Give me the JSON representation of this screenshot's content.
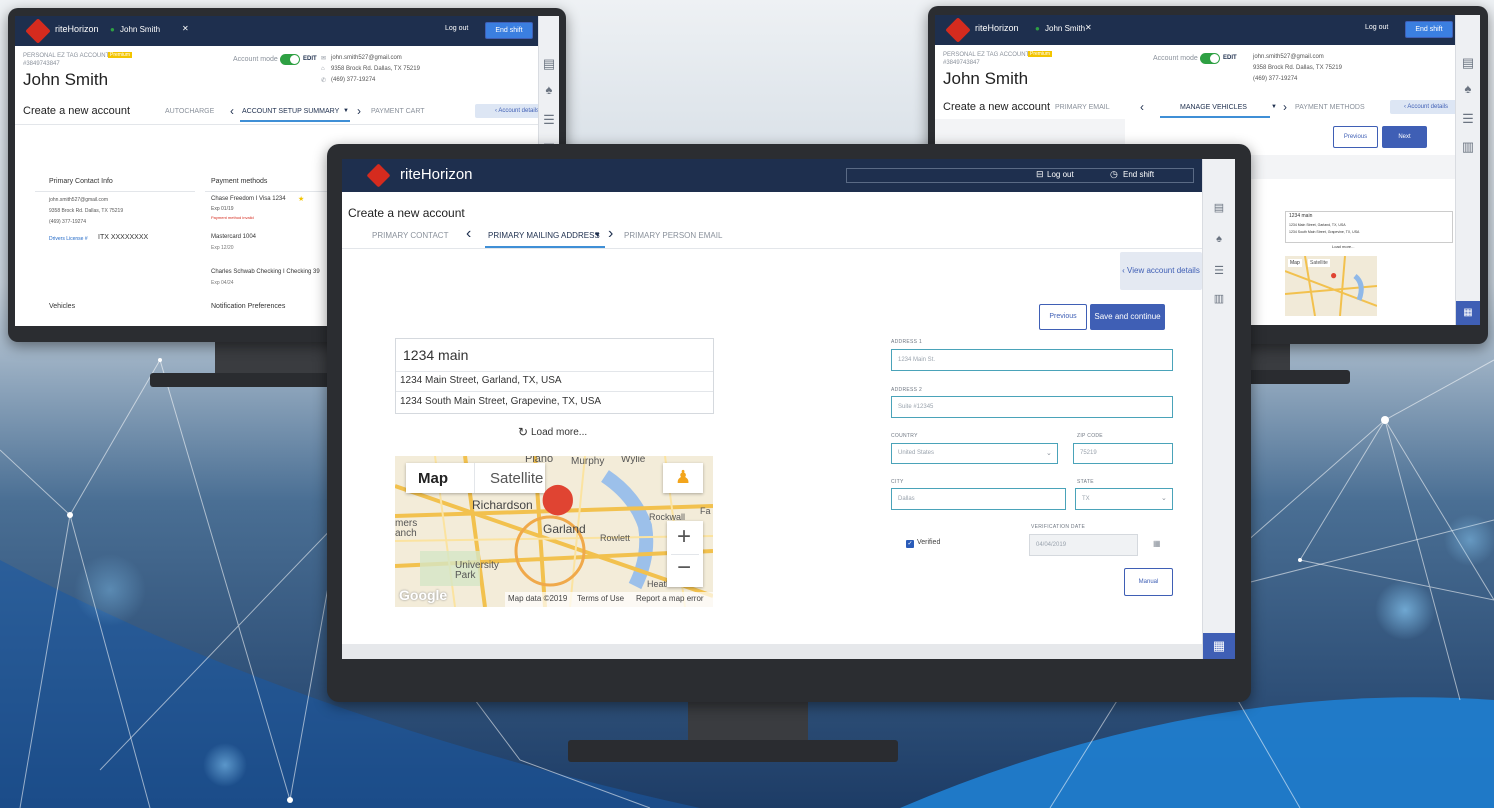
{
  "brand": {
    "logo_text": "riteHorizon",
    "accent": "#d52b1e",
    "nav_bg": "#1e2f4e",
    "primary": "#3f5fb5"
  },
  "left_monitor": {
    "tab_user": "John Smith",
    "logout": "Log out",
    "end_shift": "End shift",
    "account_type": "PERSONAL EZ TAG ACCOUNT",
    "account_badge": "Premium",
    "account_number": "#3849743847",
    "customer_name": "John Smith",
    "account_mode_label": "Account mode",
    "edit_label": "EDIT",
    "email": "john.smith527@gmail.com",
    "address": "9358 Brock Rd. Dallas, TX 75219",
    "phone": "(469) 377-19274",
    "page_title": "Create a new account",
    "step_prev": "AUTOCHARGE",
    "step_current": "ACCOUNT SETUP SUMMARY",
    "step_next": "PAYMENT CART",
    "account_details": "‹ Account details",
    "contact_heading": "Primary Contact Info",
    "contact_email": "john.smith527@gmail.com",
    "contact_address": "9358 Brock Rd. Dallas, TX 75219",
    "contact_phone": "(469) 377-19274",
    "drivers_license_label": "Drivers License #",
    "drivers_license_value": "ITX XXXXXXXX",
    "payment_heading": "Payment methods",
    "pm1_name": "Chase Freedom I Visa 1234",
    "pm1_exp": "Exp 01/19",
    "pm1_warning": "Payment method invalid",
    "pm2_name": "Mastercard 1004",
    "pm2_exp": "Exp 12/20",
    "pm3_name": "Charles Schwab Checking I Checking 39",
    "pm3_exp": "Exp 04/24",
    "vehicles_heading": "Vehicles",
    "notifications_heading": "Notification Preferences"
  },
  "right_monitor": {
    "tab_user": "John Smith",
    "logout": "Log out",
    "end_shift": "End shift",
    "account_type": "PERSONAL EZ TAG ACCOUNT",
    "account_badge": "Premium",
    "account_number": "#3849743847",
    "customer_name": "John Smith",
    "account_mode_label": "Account mode",
    "edit_label": "EDIT",
    "email": "john.smith527@gmail.com",
    "address": "9358 Brock Rd. Dallas, TX 75219",
    "phone": "(469) 377-19274",
    "page_title": "Create a new account",
    "step_prev": "PRIMARY EMAIL",
    "step_current": "MANAGE VEHICLES",
    "step_next": "PAYMENT METHODS",
    "account_details": "‹ Account details",
    "previous": "Previous",
    "next": "Next",
    "search_value": "1234 main",
    "suggestion_1": "1234 Main Street, Garland, TX, USA",
    "suggestion_2": "1234 South Main Street, Grapevine, TX, USA",
    "load_more": "Load more...",
    "map_tab": "Map",
    "satellite_tab": "Satellite"
  },
  "main_monitor": {
    "logout": "Log out",
    "end_shift": "End shift",
    "page_title": "Create a new account",
    "step_prev": "PRIMARY CONTACT",
    "step_current": "PRIMARY MAILING ADDRESS",
    "step_next": "PRIMARY PERSON EMAIL",
    "view_account_details": "‹ View account details",
    "previous": "Previous",
    "save_continue": "Save and continue",
    "search_value": "1234 main",
    "suggestion_1": "1234 Main Street, Garland, TX, USA",
    "suggestion_2": "1234 South Main Street, Grapevine, TX, USA",
    "load_more": "Load more...",
    "map": {
      "map_tab": "Map",
      "satellite_tab": "Satellite",
      "places": [
        "Plano",
        "Murphy",
        "Wylie",
        "Richardson",
        "Garland",
        "Rowlett",
        "Rockwall",
        "University Park",
        "Heath",
        "mers",
        "anch",
        "Fa"
      ],
      "attribution_logo": "Google",
      "attribution": "Map data ©2019",
      "terms": "Terms of Use",
      "report": "Report a map error",
      "zoom_in": "+",
      "zoom_out": "−"
    },
    "form": {
      "address1_label": "ADDRESS 1",
      "address1_placeholder": "1234 Main St.",
      "address2_label": "ADDRESS 2",
      "address2_placeholder": "Suite #12345",
      "country_label": "COUNTRY",
      "country_value": "United States",
      "zip_label": "ZIP CODE",
      "zip_value": "75219",
      "city_label": "CITY",
      "city_value": "Dallas",
      "state_label": "STATE",
      "state_value": "TX",
      "verified_label": "Verified",
      "verification_date_label": "VERIFICATION DATE",
      "verification_date_value": "04/04/2019",
      "manual_button": "Manual"
    }
  }
}
